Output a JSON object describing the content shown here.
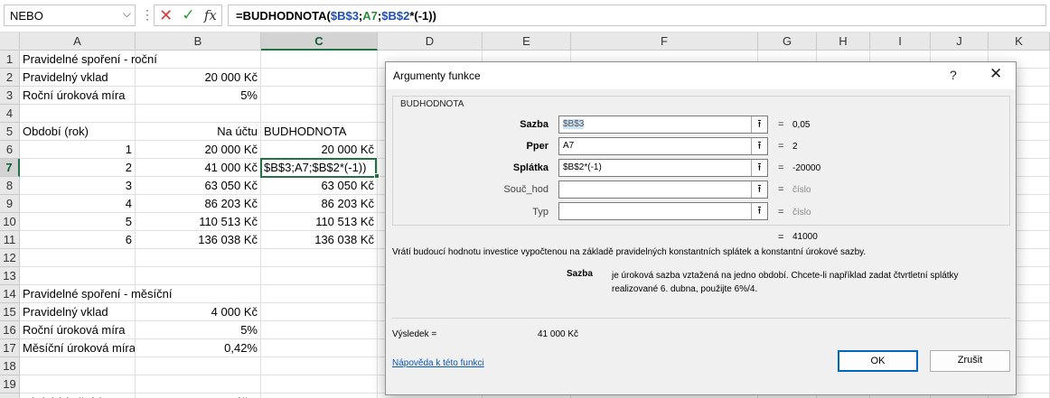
{
  "formula_bar": {
    "name_box": "NEBO",
    "fx": "fx",
    "formula_prefix": "=BUDHODNOTA(",
    "formula_ref1": "$B$3",
    "formula_sep1": ";",
    "formula_ref2": "A7",
    "formula_sep2": ";",
    "formula_ref3": "$B$2",
    "formula_suffix": "*(-1))"
  },
  "columns": [
    "A",
    "B",
    "C",
    "D",
    "E",
    "F",
    "G",
    "H",
    "I",
    "J",
    "K"
  ],
  "rows": [
    "1",
    "2",
    "3",
    "4",
    "5",
    "6",
    "7",
    "8",
    "9",
    "10",
    "11",
    "12",
    "13",
    "14",
    "15",
    "16",
    "17",
    "18",
    "19",
    "20"
  ],
  "cells": {
    "A1": "Pravidelné spoření - roční",
    "A2": "Pravidelný vklad",
    "B2": "20 000 Kč",
    "A3": "Roční úroková míra",
    "B3": "5%",
    "A5": "Období (rok)",
    "B5": "Na účtu",
    "C5": "BUDHODNOTA",
    "A6": "1",
    "B6": "20 000 Kč",
    "C6": "20 000 Kč",
    "A7": "2",
    "B7": "41 000 Kč",
    "C7": "$B$3;A7;$B$2*(-1))",
    "A8": "3",
    "B8": "63 050 Kč",
    "C8": "63 050 Kč",
    "A9": "4",
    "B9": "86 203 Kč",
    "C9": "86 203 Kč",
    "A10": "5",
    "B10": "110 513 Kč",
    "C10": "110 513 Kč",
    "A11": "6",
    "B11": "136 038 Kč",
    "C11": "136 038 Kč",
    "A14": "Pravidelné spoření - měsíční",
    "A15": "Pravidelný vklad",
    "B15": "4 000 Kč",
    "A16": "Roční úroková míra",
    "B16": "5%",
    "A17": "Měsíční úroková míra",
    "B17": "0,42%",
    "A20": "Období (měsíc)",
    "B20": "Na účtu",
    "C20": "BUDHODNOTA"
  },
  "dialog": {
    "title": "Argumenty funkce",
    "help_glyph": "?",
    "close_glyph": "✕",
    "function_name": "BUDHODNOTA",
    "args": [
      {
        "label": "Sazba",
        "value": "$B$3",
        "result": "0,05"
      },
      {
        "label": "Pper",
        "value": "A7",
        "result": "2"
      },
      {
        "label": "Splátka",
        "value": "$B$2*(-1)",
        "result": "-20000"
      },
      {
        "label": "Souč_hod",
        "value": "",
        "result": "číslo"
      },
      {
        "label": "Typ",
        "value": "",
        "result": "číslo"
      }
    ],
    "eq": "=",
    "formula_result": "41000",
    "description": "Vrátí budoucí hodnotu investice vypočtenou na základě pravidelných konstantních splátek a konstantní úrokové sazby.",
    "arg_desc_name": "Sazba",
    "arg_desc_text": "je úroková sazba vztažená na jedno období. Chcete-li například zadat čtvrtletní splátky realizované 6. dubna, použijte 6%/4.",
    "result_label": "Výsledek =",
    "result_value": "41 000 Kč",
    "help_link": "Nápověda k této funkci",
    "ok_label": "OK",
    "cancel_label": "Zrušit"
  },
  "colors": {
    "accent_green": "#217346",
    "ok_border": "#0067c0",
    "link": "#0b59b8"
  }
}
